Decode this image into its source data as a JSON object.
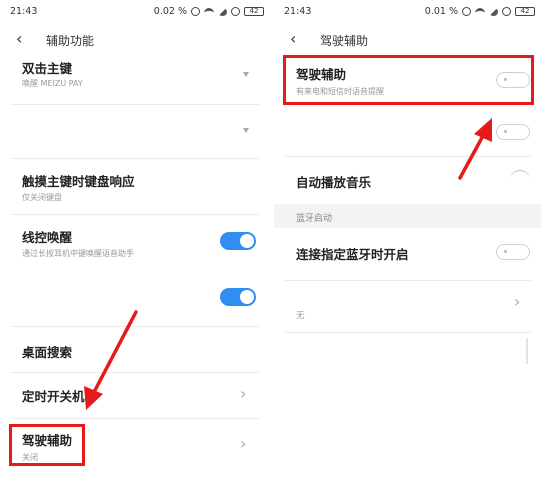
{
  "left": {
    "status": {
      "time": "21:43",
      "indicators": "0.02 %",
      "battery": "42"
    },
    "header": {
      "title": "辅助功能"
    },
    "items": [
      {
        "title": "双击主键",
        "subtitle": "唤醒 MEIZU PAY",
        "control": "dropdown"
      },
      {
        "title": "",
        "control": "dropdown"
      },
      {
        "title": "触摸主键时键盘响应",
        "subtitle": "仅关闭键盘",
        "control": "none"
      },
      {
        "title": "线控唤醒",
        "subtitle": "通过长按耳机中键唤醒语音助手",
        "control": "toggle",
        "state": "on"
      },
      {
        "title": "",
        "control": "toggle",
        "state": "on"
      },
      {
        "title": "桌面搜索",
        "control": "none"
      },
      {
        "title": "定时开关机",
        "control": "chevron"
      },
      {
        "title": "驾驶辅助",
        "subtitle": "关闭",
        "control": "chevron",
        "highlighted": true
      }
    ]
  },
  "right": {
    "status": {
      "time": "21:43",
      "indicators": "0.01 %",
      "battery": "42"
    },
    "header": {
      "title": "驾驶辅助"
    },
    "items": [
      {
        "title": "驾驶辅助",
        "subtitle": "有来电和短信时语音提醒",
        "control": "toggle",
        "state": "off",
        "highlighted": true
      },
      {
        "title": "",
        "control": "toggle",
        "state": "off"
      },
      {
        "title": "自动播放音乐",
        "control": "toggle",
        "state": "partial"
      },
      {
        "title": "连接指定蓝牙时开启",
        "control": "toggle",
        "state": "off"
      },
      {
        "title": "",
        "subtitle": "无",
        "control": "chevron"
      }
    ],
    "section": {
      "label": "蓝牙启动"
    }
  },
  "colors": {
    "accent": "#2f8ef0",
    "highlight": "#e51a1a"
  },
  "icons": [
    "back-arrow-icon",
    "chevron-right-icon",
    "dropdown-triangle-icon",
    "red-arrow-icon"
  ]
}
